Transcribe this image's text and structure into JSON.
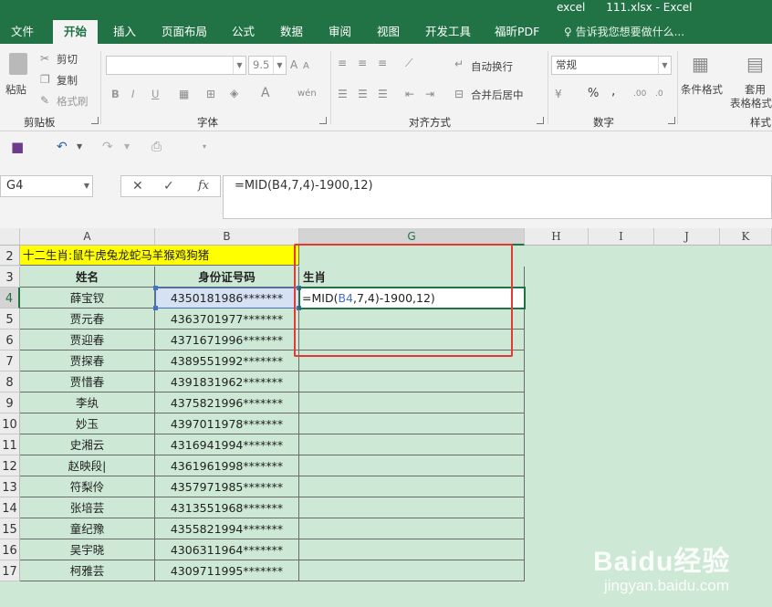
{
  "window": {
    "title": "excel      111.xlsx - Excel"
  },
  "tabs": [
    "文件",
    "开始",
    "插入",
    "页面布局",
    "公式",
    "数据",
    "审阅",
    "视图",
    "开发工具",
    "福昕PDF"
  ],
  "tell_me": "♀ 告诉我您想要做什么...",
  "ribbon": {
    "clipboard": {
      "paste": "粘贴",
      "cut": "剪切",
      "copy": "复制",
      "format_painter": "格式刷",
      "label": "剪贴板"
    },
    "font": {
      "size": "9.5",
      "bold": "B",
      "italic": "I",
      "underline": "U",
      "label": "字体"
    },
    "alignment": {
      "wrap": "自动换行",
      "merge": "合并后居中",
      "label": "对齐方式"
    },
    "number": {
      "format": "常规",
      "percent": "%",
      "comma": ",",
      "label": "数字"
    },
    "styles": {
      "conditional": "条件格式",
      "table1": "套用",
      "table2": "表格格式",
      "label": "样式"
    }
  },
  "name_box": "G4",
  "formula": "=MID(B4,7,4)-1900,12)",
  "columns": [
    "A",
    "B",
    "G",
    "H",
    "I",
    "J",
    "K"
  ],
  "rows": [
    "2",
    "3",
    "4",
    "5",
    "6",
    "7",
    "8",
    "9",
    "10",
    "11",
    "12",
    "13",
    "14",
    "15",
    "16",
    "17"
  ],
  "sheet": {
    "zodiac_note": "十二生肖:鼠牛虎兔龙蛇马羊猴鸡狗猪",
    "header": {
      "name": "姓名",
      "id": "身份证号码",
      "zodiac": "生肖"
    },
    "edit": {
      "prefix": "=MID(",
      "ref": "B4",
      "suffix": ",7,4)-1900,12)"
    },
    "records": [
      {
        "name": "薛宝钗",
        "id": "4350181986*******"
      },
      {
        "name": "贾元春",
        "id": "4363701977*******"
      },
      {
        "name": "贾迎春",
        "id": "4371671996*******"
      },
      {
        "name": "贾探春",
        "id": "4389551992*******"
      },
      {
        "name": "贾惜春",
        "id": "4391831962*******"
      },
      {
        "name": "李纨",
        "id": "4375821996*******"
      },
      {
        "name": "妙玉",
        "id": "4397011978*******"
      },
      {
        "name": "史湘云",
        "id": "4316941994*******"
      },
      {
        "name": "赵映段|",
        "id": "4361961998*******"
      },
      {
        "name": "符梨伶",
        "id": "4357971985*******"
      },
      {
        "name": "张培芸",
        "id": "4313551968*******"
      },
      {
        "name": "童纪豫",
        "id": "4355821994*******"
      },
      {
        "name": "吴宇晓",
        "id": "4306311964*******"
      },
      {
        "name": "柯雅芸",
        "id": "4309711995*******"
      }
    ]
  },
  "watermark": {
    "logo": "Baidu经验",
    "url": "jingyan.baidu.com"
  },
  "colors": {
    "excel_green": "#217346",
    "sheet_bg": "#cde8d4",
    "highlight": "#ffff00",
    "annotation_red": "#e53935"
  }
}
